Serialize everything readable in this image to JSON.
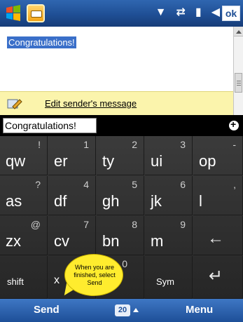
{
  "status": {
    "ok_label": "ok",
    "icons": [
      "dropdown-icon",
      "connectivity-icon",
      "signal-icon",
      "volume-icon"
    ]
  },
  "message": {
    "selected_text": "Congratulations!"
  },
  "edit": {
    "link_label": "Edit sender's message"
  },
  "input": {
    "value": "Congratulations!"
  },
  "keyboard": {
    "rows": [
      [
        {
          "main": "qw",
          "sub": "!"
        },
        {
          "main": "er",
          "sub": "1"
        },
        {
          "main": "ty",
          "sub": "2"
        },
        {
          "main": "ui",
          "sub": "3"
        },
        {
          "main": "op",
          "sub": "-"
        }
      ],
      [
        {
          "main": "as",
          "sub": "?"
        },
        {
          "main": "df",
          "sub": "4"
        },
        {
          "main": "gh",
          "sub": "5"
        },
        {
          "main": "jk",
          "sub": "6"
        },
        {
          "main": "l",
          "sub": ","
        }
      ],
      [
        {
          "main": "zx",
          "sub": "@"
        },
        {
          "main": "cv",
          "sub": "7"
        },
        {
          "main": "bn",
          "sub": "8"
        },
        {
          "main": "m",
          "sub": "9"
        },
        {
          "main": "←",
          "sub": ""
        }
      ],
      [
        {
          "main": "shift",
          "sub": ""
        },
        {
          "main": "x",
          "sub": ""
        },
        {
          "main": "",
          "sub": "0"
        },
        {
          "main": "Sym",
          "sub": ""
        },
        {
          "main": "↵",
          "sub": ""
        }
      ]
    ]
  },
  "tooltip": {
    "text": "When you are finished, select Send"
  },
  "softkeys": {
    "left": "Send",
    "center": "20",
    "right": "Menu"
  }
}
